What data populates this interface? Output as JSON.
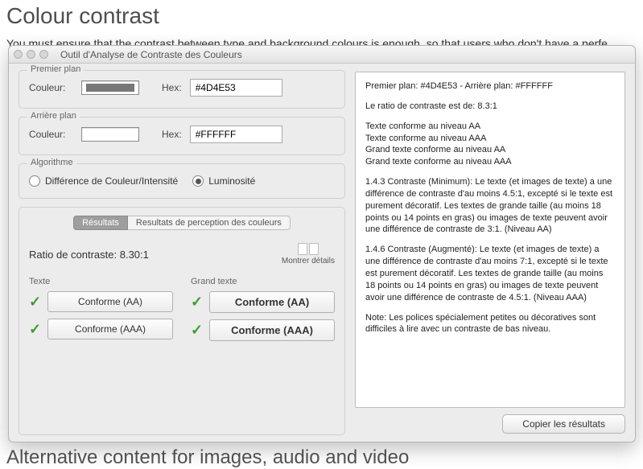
{
  "page": {
    "heading": "Colour contrast",
    "intro": "You must ensure that the contrast between type and background colours is enough, so that users who don't have a perfe",
    "next_heading": "Alternative content for images, audio and video"
  },
  "window": {
    "title": "Outil d'Analyse de Contraste des Couleurs"
  },
  "foreground": {
    "legend": "Premier plan",
    "color_label": "Couleur:",
    "hex_label": "Hex:",
    "hex_value": "#4D4E53",
    "swatch_color": "#777777"
  },
  "background": {
    "legend": "Arrière plan",
    "color_label": "Couleur:",
    "hex_label": "Hex:",
    "hex_value": "#FFFFFF",
    "swatch_color": "#ffffff"
  },
  "algorithm": {
    "legend": "Algorithme",
    "option1": "Différence de Couleur/Intensité",
    "option2": "Luminosité",
    "selected": "option2"
  },
  "results": {
    "tab1": "Résultats",
    "tab2": "Resultats de perception des couleurs",
    "active_tab": "tab1",
    "ratio_label": "Ratio de contraste: 8.30:1",
    "show_details": "Montrer détails",
    "col_text": "Texte",
    "col_bigtext": "Grand texte",
    "text_aa": "Conforme (AA)",
    "text_aaa": "Conforme (AAA)",
    "big_aa": "Conforme (AA)",
    "big_aaa": "Conforme (AAA)"
  },
  "output": {
    "line1": "Premier plan: #4D4E53 - Arrière plan: #FFFFFF",
    "line2": "Le ratio de contraste est de: 8.3:1",
    "line3": "Texte conforme au niveau AA",
    "line4": "Texte conforme au niveau AAA",
    "line5": "Grand texte conforme au niveau AA",
    "line6": "Grand texte conforme au niveau AAA",
    "para1": "1.4.3 Contraste (Minimum):  Le texte (et images de texte) a une différence de contraste d'au moins 4.5:1, excepté si le texte est purement décoratif. Les textes de grande taille (au moins 18 points ou 14 points en gras) ou images de texte peuvent avoir une différence de contraste de 3:1. (Niveau AA)",
    "para2": "1.4.6 Contraste (Augmenté): Le texte (et images de texte) a une différence de contraste d'au moins 7:1, excepté si le texte est purement décoratif. Les textes de grande taille (au moins 18 points ou 14 points en gras) ou images de texte peuvent avoir une différence de contraste de 4.5:1. (Niveau AAA)",
    "note": "Note: Les polices spécialement petites ou décoratives sont difficiles à lire avec un contraste de bas niveau.",
    "copy_button": "Copier les résultats"
  }
}
